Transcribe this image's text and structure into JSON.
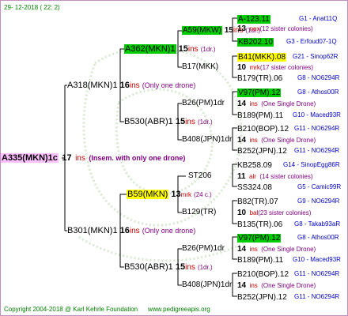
{
  "header": {
    "date": "29- 12-2018 ( 22: 2)"
  },
  "footer": {
    "copyright": "Copyright 2004-2018 @ Karl Kehrle Foundation",
    "website": "www.pedigreeapis.org"
  },
  "root": {
    "label": "A335(MKN)1c",
    "ins_count": "17",
    "ins_word": "ins",
    "note": "(Insem. with only one drone)"
  },
  "gen1": [
    {
      "label": "A318(MKN)1",
      "ins_count": "16",
      "ins_word": "ins",
      "note": "(Only one drone)"
    },
    {
      "label": "B301(MKN)1",
      "ins_count": "16",
      "ins_word": "ins",
      "note": "(Only one drone)"
    }
  ],
  "gen2": [
    {
      "label": "A362(MKN)1",
      "ins_count": "15",
      "ins_word": "ins",
      "note": "(1dr.)"
    },
    {
      "label": "B530(ABR)1",
      "ins_count": "15",
      "ins_word": "ins",
      "note": "(1dr.)"
    },
    {
      "label": "B59(MKN)",
      "ins_count": "13",
      "ins_word": "mrk",
      "note": "(24 c.)"
    },
    {
      "label": "B530(ABR)1",
      "ins_count": "15",
      "ins_word": "ins",
      "note": "(1dr.)"
    }
  ],
  "gen3": [
    {
      "label": "A59(MKW)",
      "ins_count": "15",
      "ins_word": "ins",
      "note": "(1dr.)"
    },
    {
      "label": "B17(MKK)",
      "ins_count": "",
      "ins_word": "",
      "note": ""
    },
    {
      "label": "B26(PM)1dr",
      "ins_count": "",
      "ins_word": "",
      "note": ""
    },
    {
      "label": "B408(JPN)1dr",
      "ins_count": "",
      "ins_word": "",
      "note": ""
    },
    {
      "label": "ST206",
      "ins_count": "",
      "ins_word": "",
      "note": ""
    },
    {
      "label": "B129(TR)",
      "ins_count": "",
      "ins_word": "",
      "note": ""
    },
    {
      "label": "B26(PM)1dr",
      "ins_count": "",
      "ins_word": "",
      "note": ""
    },
    {
      "label": "B408(JPN)1dr",
      "ins_count": "",
      "ins_word": "",
      "note": ""
    }
  ],
  "gen4": [
    {
      "sire": "A-123.11",
      "code": "G1 - Anat11Q",
      "count": "13",
      "word": "nex",
      "sisters": "(12 sister colonies)"
    },
    {
      "sire": "KB202.10",
      "code": "G3 - Erfoud07-1Q"
    },
    {
      "sire": "B41(MKK).08",
      "code": "G21 - Sinop62R",
      "count": "10",
      "word": "mrk",
      "sisters": "(17 sister colonies)"
    },
    {
      "sire": "B179(TR).06",
      "code": "G8 - NO6294R"
    },
    {
      "sire": "V97(PM).12",
      "code": "G8 - Athos00R",
      "count": "14",
      "word": "ins",
      "sisters": "(One Single Drone)"
    },
    {
      "sire": "B189(PM).11",
      "code": "G10 - Maced93R"
    },
    {
      "sire": "B210(BOP).12",
      "code": "G11 - NO6294R",
      "count": "14",
      "word": "ins",
      "sisters": "(One Single Drone)"
    },
    {
      "sire": "B252(JPN).12",
      "code": "G11 - NO6294R"
    },
    {
      "sire": "KB258.09",
      "code": "G14 - SinopEgg86R",
      "count": "11",
      "word": "alr",
      "sisters": "(14 sister colonies)"
    },
    {
      "sire": "SS324.08",
      "code": "G5 - Camic99R"
    },
    {
      "sire": "B82(TR).07",
      "code": "G9 - NO6294R",
      "count": "10",
      "word": "bal",
      "sisters": "(23 sister colonies)"
    },
    {
      "sire": "B135(TR).06",
      "code": "G8 - Takab93aR"
    },
    {
      "sire": "V97(PM).12",
      "code": "G8 - Athos00R",
      "count": "14",
      "word": "ins",
      "sisters": "(One Single Drone)"
    },
    {
      "sire": "B189(PM).11",
      "code": "G10 - Maced93R"
    },
    {
      "sire": "B210(BOP).12",
      "code": "G11 - NO6294R",
      "count": "14",
      "word": "ins",
      "sisters": "(One Single Drone)"
    },
    {
      "sire": "B252(JPN).12",
      "code": "G11 - NO6294R"
    }
  ],
  "colors": {
    "frame": "#c090c0",
    "root_bg": "#ffc0ff",
    "green_bg": "#00cc00",
    "yellow_bg": "#ffff00",
    "ins_red": "#cc0000",
    "code_blue": "#0000cc"
  }
}
